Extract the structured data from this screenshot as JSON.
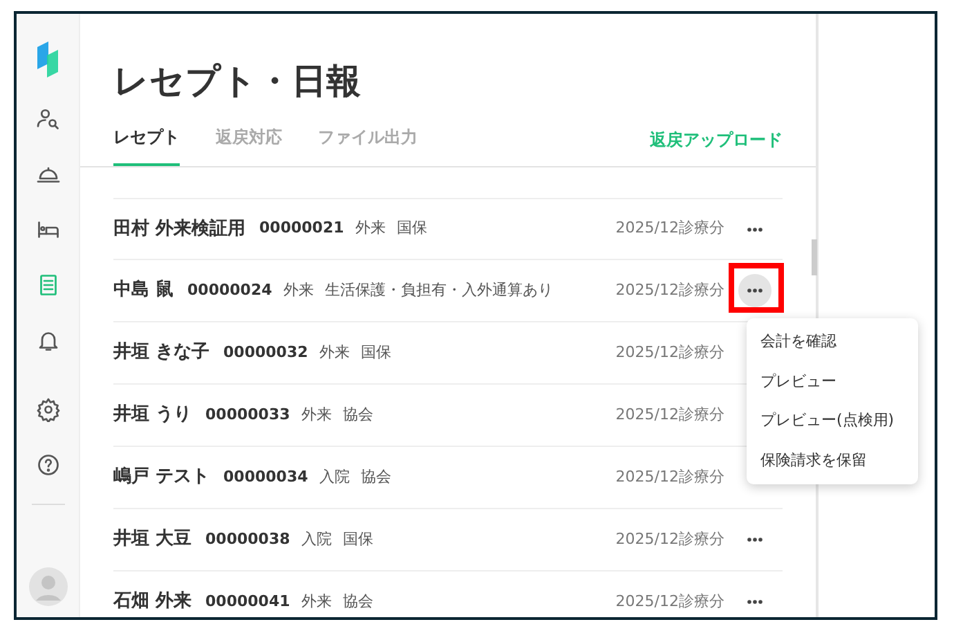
{
  "sidebar": {
    "items": [
      {
        "kind": "patient-search",
        "selected": false
      },
      {
        "kind": "reception",
        "selected": false
      },
      {
        "kind": "bed",
        "selected": false
      },
      {
        "kind": "list",
        "selected": true
      },
      {
        "kind": "bell",
        "selected": false
      },
      {
        "kind": "settings",
        "selected": false
      },
      {
        "kind": "help",
        "selected": false
      }
    ]
  },
  "title": "レセプト・日報",
  "tabs": [
    {
      "label": "レセプト",
      "selected": true
    },
    {
      "label": "返戻対応",
      "selected": false
    },
    {
      "label": "ファイル出力",
      "selected": false
    }
  ],
  "action_link": "返戻アップロード",
  "rows": [
    {
      "name": "田村 外来検証用",
      "id": "00000021",
      "visit": "外来",
      "insurance": "国保",
      "period": "2025/12診療分",
      "menu_open": false
    },
    {
      "name": "中島 鼠",
      "id": "00000024",
      "visit": "外来",
      "insurance": "生活保護・負担有・入外通算あり",
      "period": "2025/12診療分",
      "menu_open": true
    },
    {
      "name": "井垣 きな子",
      "id": "00000032",
      "visit": "外来",
      "insurance": "国保",
      "period": "2025/12診療分",
      "menu_open": false
    },
    {
      "name": "井垣 うり",
      "id": "00000033",
      "visit": "外来",
      "insurance": "協会",
      "period": "2025/12診療分",
      "menu_open": false
    },
    {
      "name": "嶋戸 テスト",
      "id": "00000034",
      "visit": "入院",
      "insurance": "協会",
      "period": "2025/12診療分",
      "menu_open": false
    },
    {
      "name": "井垣 大豆",
      "id": "00000038",
      "visit": "入院",
      "insurance": "国保",
      "period": "2025/12診療分",
      "menu_open": false
    },
    {
      "name": "石畑 外来",
      "id": "00000041",
      "visit": "外来",
      "insurance": "協会",
      "period": "2025/12診療分",
      "menu_open": false
    }
  ],
  "context_menu": {
    "items": [
      "会計を確認",
      "プレビュー",
      "プレビュー(点検用)",
      "保険請求を保留"
    ]
  }
}
